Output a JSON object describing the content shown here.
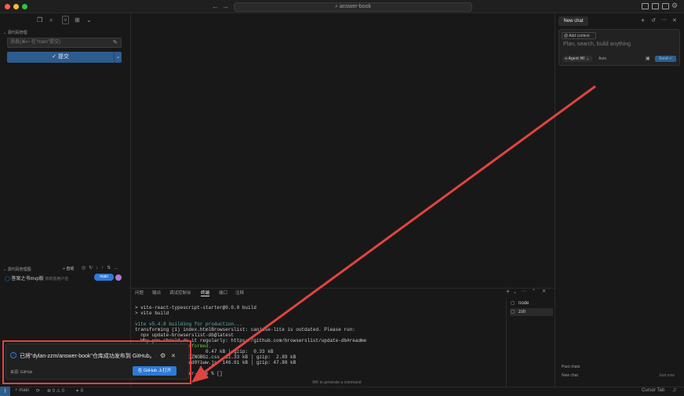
{
  "titlebar": {
    "search_text": "answer-book",
    "back_arrow": "←",
    "forward_arrow": "→"
  },
  "sidebar": {
    "source_control_title": "源代码管理",
    "commit_placeholder": "消息(⌘↩ 在\"main\"提交)",
    "commit_button": "✓ 提交",
    "commit_dropdown": "⌄",
    "graph_title": "源代码管理图",
    "auto_label": "自动",
    "graph_row_text": "答案之书mvp版",
    "graph_row_author": "你的前用户名",
    "branch": "main"
  },
  "right_panel": {
    "tab_label": "New chat",
    "add_context": "@ Add context",
    "placeholder": "Plan, search, build anything",
    "agent_label": "∞ Agent ⌘I ⌄",
    "auto_label": "Auto",
    "send_label": "Send ↵",
    "past_chats_title": "Past chats",
    "past_chat_item": "New chat",
    "past_chat_time": "Just now"
  },
  "panel": {
    "tabs": [
      "问题",
      "输出",
      "调试控制台",
      "终端",
      "端口",
      "注释"
    ],
    "active_tab": 3,
    "terminal_lines": [
      "> vite-react-typescript-starter@0.0.0 build",
      "> vite build",
      "",
      "vite v5.4.8 building for production...",
      "transforming (1) index.htmlBrowserslist: caniuse-lite is outdated. Please run:",
      "  npx update-browserslist-db@latest",
      "  Why you should do it regularly: https://github.com/browserslist/update-db#readme",
      "✓ 1472 modules transformed.",
      "                         0.47 kB │ gzip:  0.33 kB",
      "                  -1ZNOBGz.css  11.33 kB │ gzip:  2.89 kB",
      "                  -Wd0Yiww.js  146.61 kB │ gzip: 47.88 kB",
      "",
      "               answer-book % []"
    ],
    "terminals": [
      "node",
      "zsh"
    ],
    "generate_hint": "⌘K to generate a command"
  },
  "notification": {
    "message": "已将\"dylan-zzm/answer-book\"仓库成功发布到 GitHub。",
    "source": "来源: GitHub",
    "open_button": "在 GitHub 上打开",
    "close": "✕"
  },
  "statusbar": {
    "branch": "main",
    "errors": "⊗ 0 ⚠ 0",
    "ports": "⚭ 0",
    "cursor_tab": "Cursor Tab"
  },
  "colors": {
    "accent": "#2e7ad6",
    "annotation_red": "#e0443f",
    "background": "#181818"
  }
}
